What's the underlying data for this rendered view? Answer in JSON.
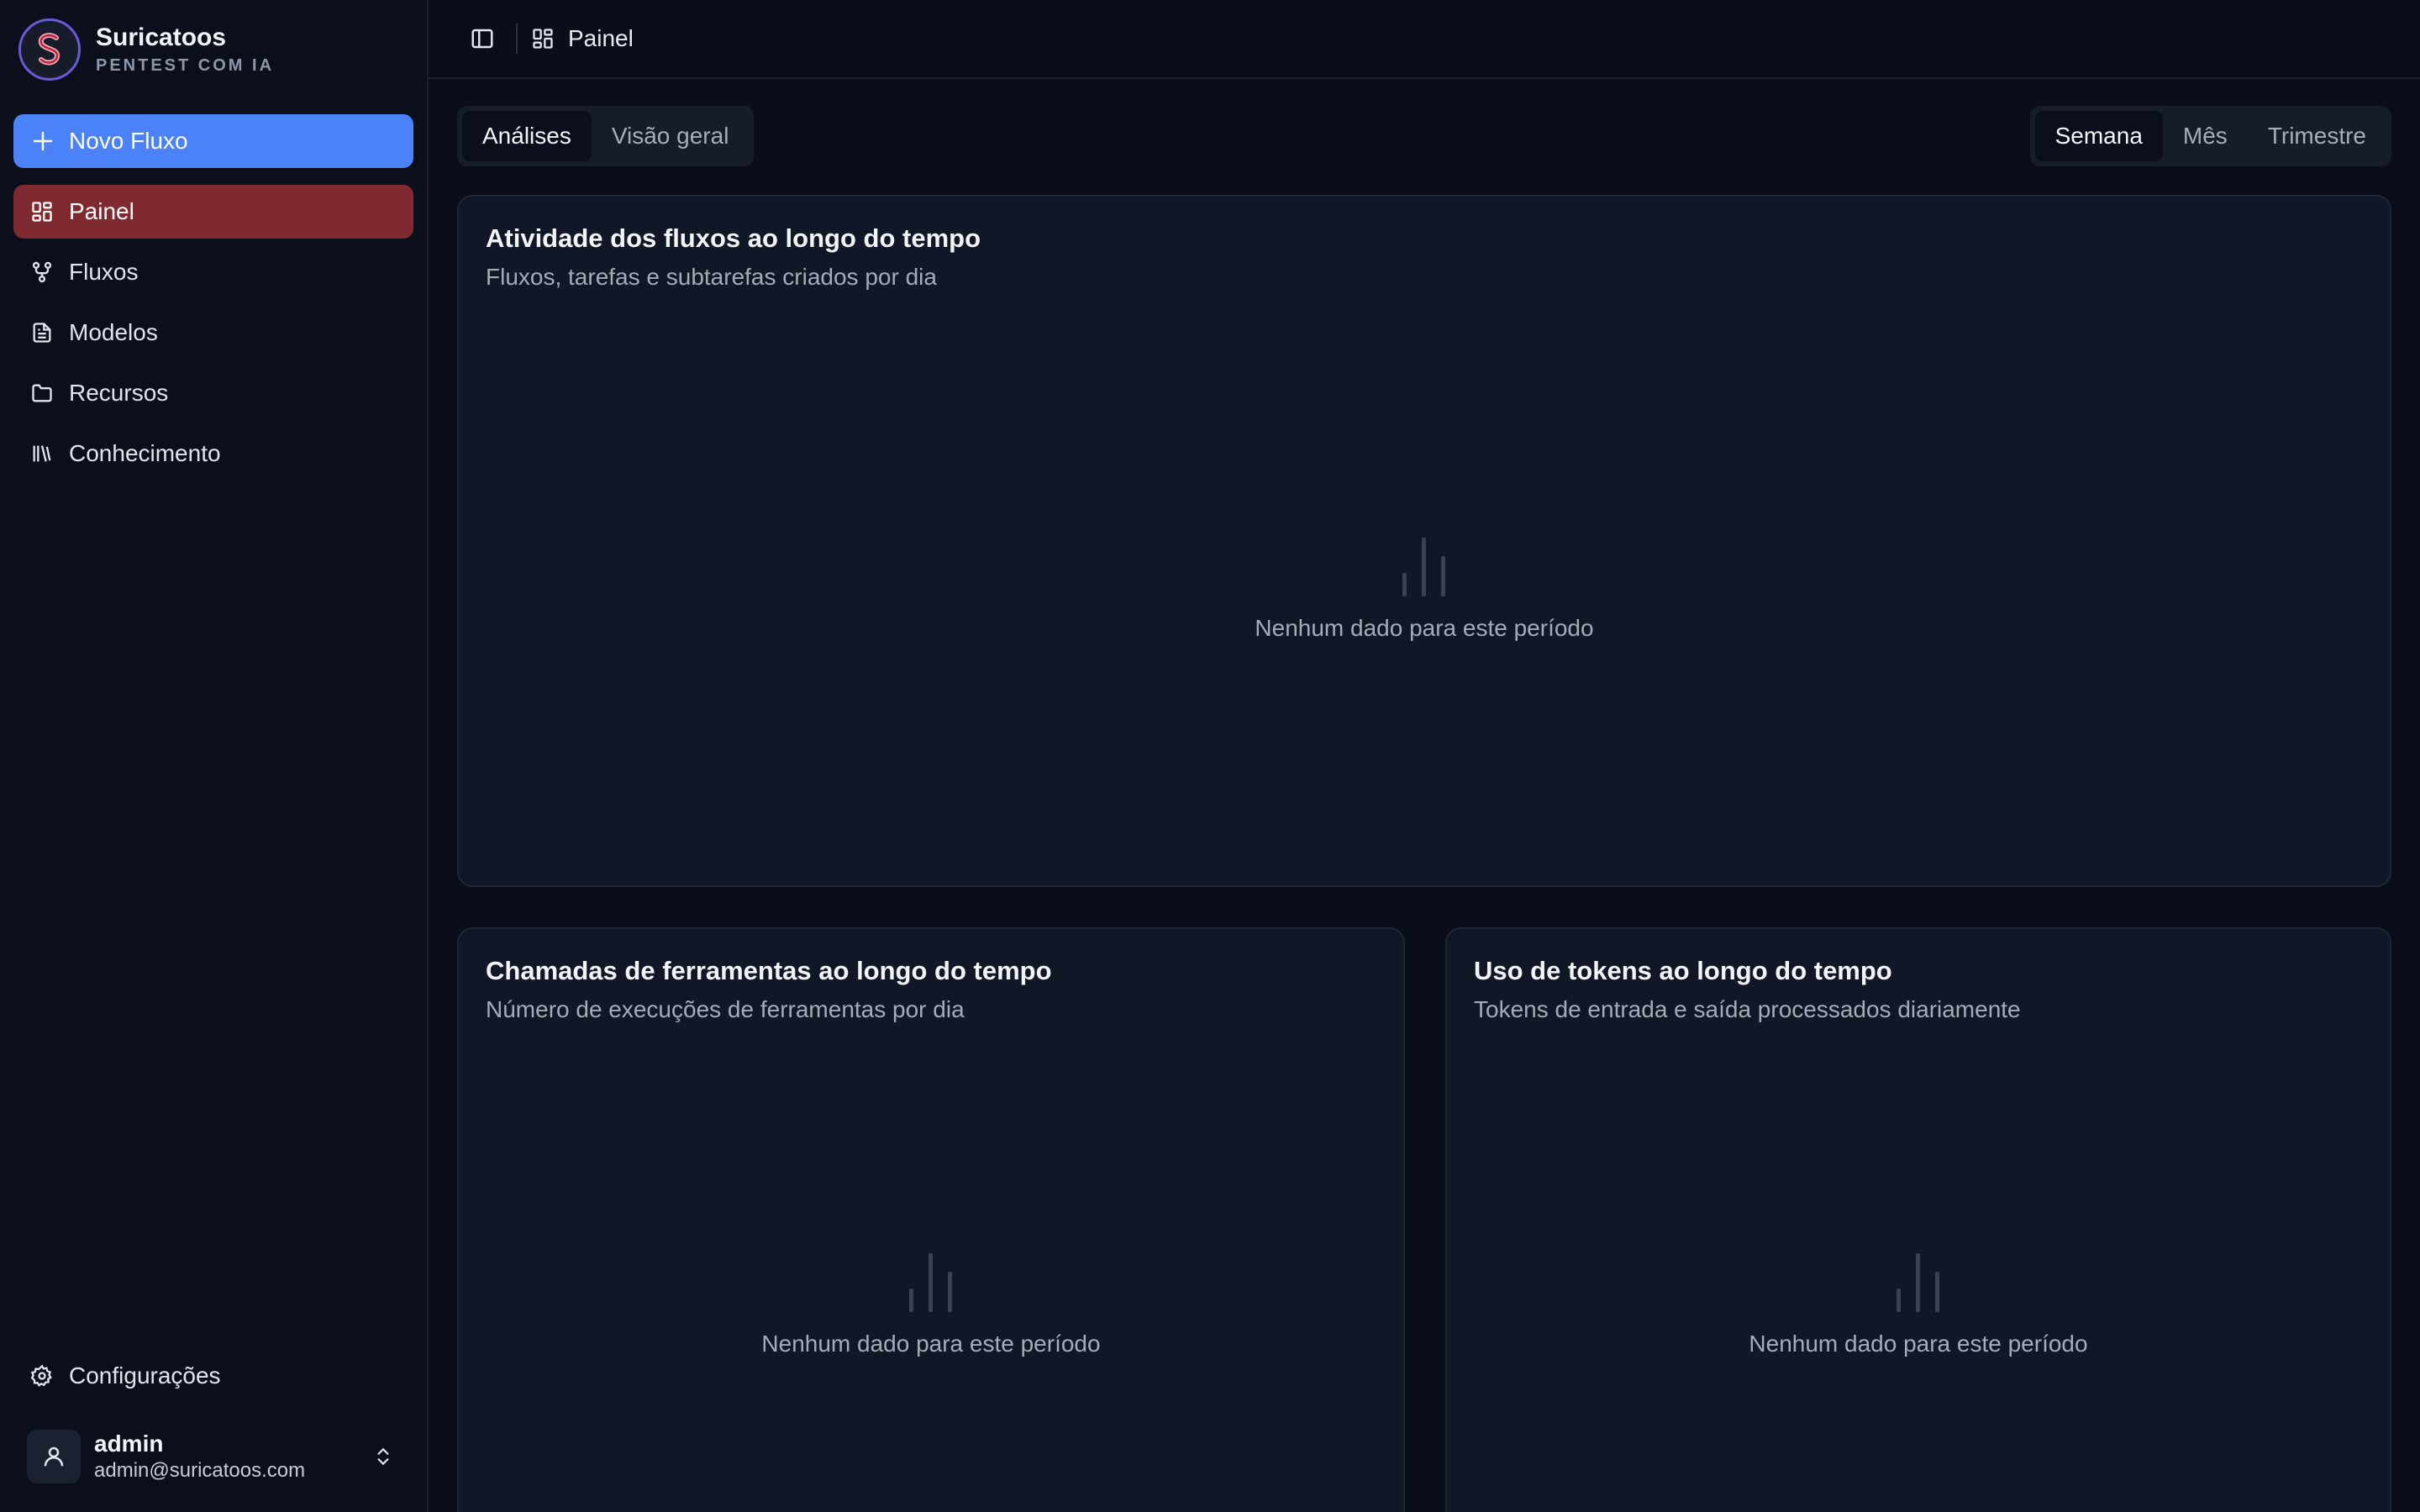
{
  "brand": {
    "name": "Suricatoos",
    "subtitle": "PENTEST COM IA"
  },
  "sidebar": {
    "new_flow_label": "Novo Fluxo",
    "items": [
      {
        "label": "Painel",
        "icon": "dashboard-icon",
        "active": true
      },
      {
        "label": "Fluxos",
        "icon": "workflow-icon",
        "active": false
      },
      {
        "label": "Modelos",
        "icon": "file-text-icon",
        "active": false
      },
      {
        "label": "Recursos",
        "icon": "folder-icon",
        "active": false
      },
      {
        "label": "Conhecimento",
        "icon": "library-icon",
        "active": false
      }
    ],
    "settings_label": "Configurações",
    "user": {
      "name": "admin",
      "email": "admin@suricatoos.com"
    }
  },
  "header": {
    "breadcrumb": "Painel"
  },
  "tabs": {
    "items": [
      "Análises",
      "Visão geral"
    ],
    "active": "Análises"
  },
  "periods": {
    "items": [
      "Semana",
      "Mês",
      "Trimestre"
    ],
    "active": "Semana"
  },
  "cards": {
    "activity": {
      "title": "Atividade dos fluxos ao longo do tempo",
      "subtitle": "Fluxos, tarefas e subtarefas criados por dia",
      "empty": "Nenhum dado para este período"
    },
    "tools": {
      "title": "Chamadas de ferramentas ao longo do tempo",
      "subtitle": "Número de execuções de ferramentas por dia",
      "empty": "Nenhum dado para este período"
    },
    "tokens": {
      "title": "Uso de tokens ao longo do tempo",
      "subtitle": "Tokens de entrada e saída processados diariamente",
      "empty": "Nenhum dado para este período"
    }
  },
  "colors": {
    "accent": "#4c82f7",
    "active_nav": "#7f2a30",
    "background": "#0a0e1a",
    "card": "#111726"
  }
}
